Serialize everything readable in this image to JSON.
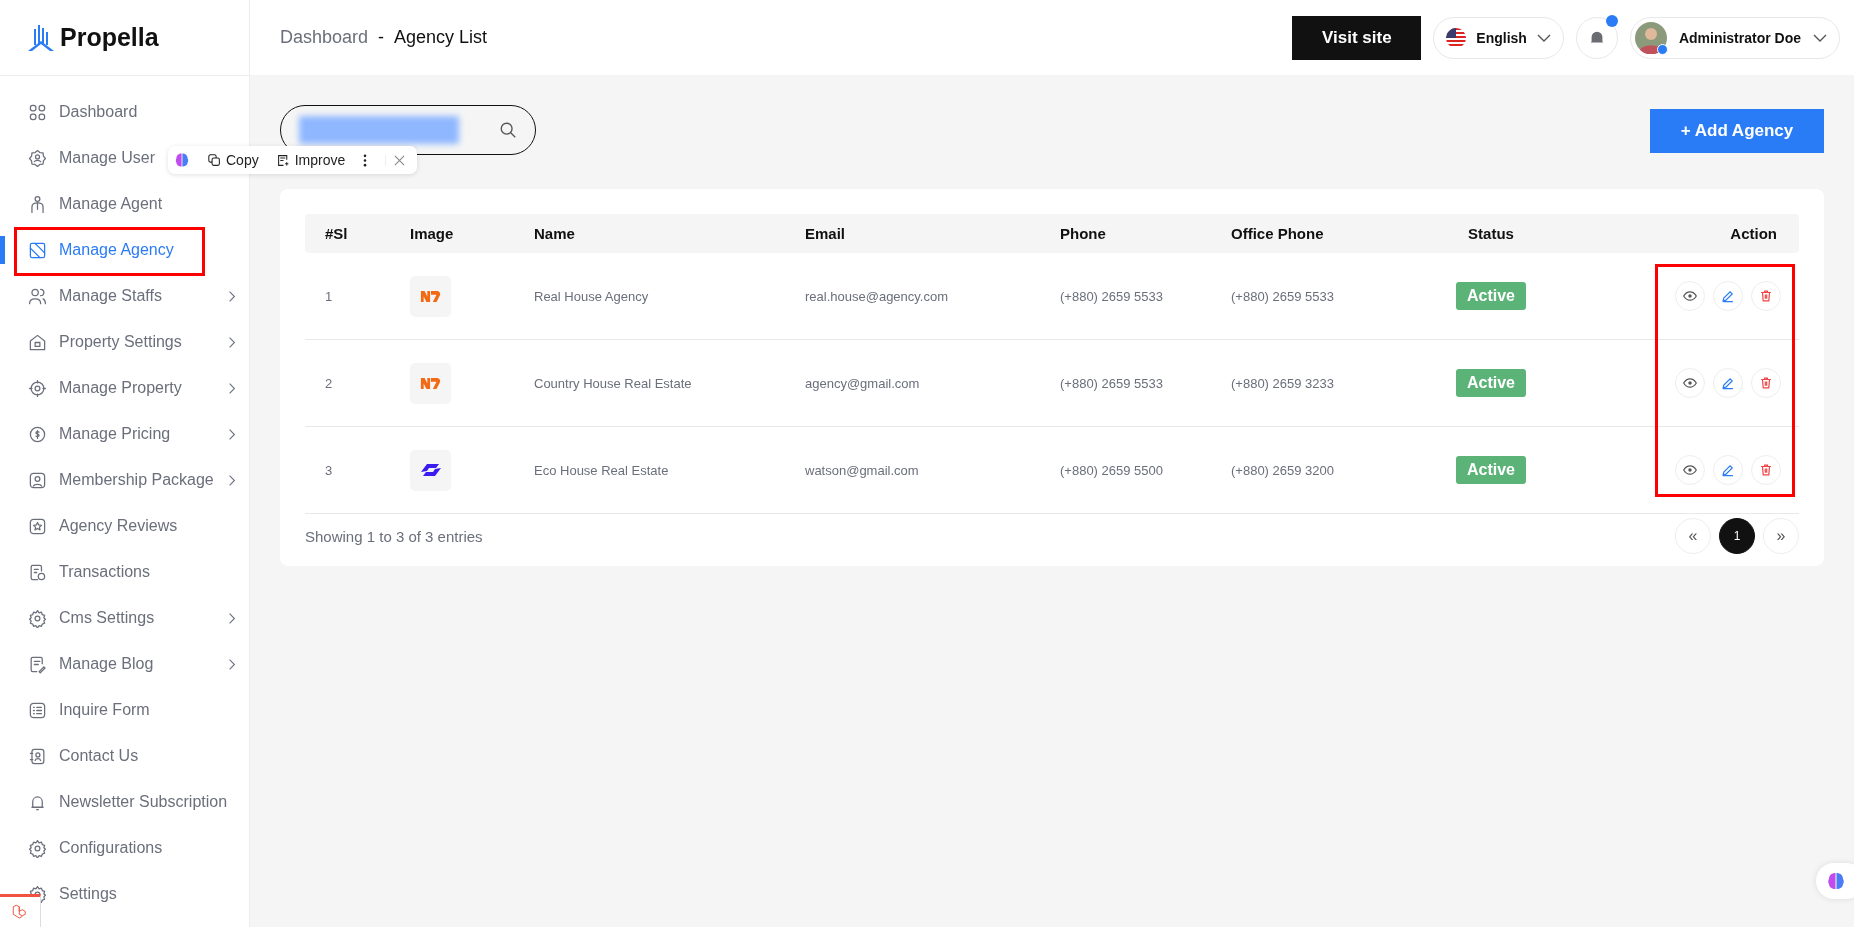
{
  "brand": {
    "name": "Propella"
  },
  "sidebar": {
    "items": [
      {
        "label": "Dashboard",
        "selected": false,
        "has_submenu": false,
        "highlighted": false
      },
      {
        "label": "Manage User",
        "selected": false,
        "has_submenu": false,
        "highlighted": false
      },
      {
        "label": "Manage Agent",
        "selected": false,
        "has_submenu": false,
        "highlighted": false
      },
      {
        "label": "Manage Agency",
        "selected": true,
        "has_submenu": false,
        "highlighted": true
      },
      {
        "label": "Manage Staffs",
        "selected": false,
        "has_submenu": true,
        "highlighted": false
      },
      {
        "label": "Property Settings",
        "selected": false,
        "has_submenu": true,
        "highlighted": false
      },
      {
        "label": "Manage Property",
        "selected": false,
        "has_submenu": true,
        "highlighted": false
      },
      {
        "label": "Manage Pricing",
        "selected": false,
        "has_submenu": true,
        "highlighted": false
      },
      {
        "label": "Membership Package",
        "selected": false,
        "has_submenu": true,
        "highlighted": false
      },
      {
        "label": "Agency Reviews",
        "selected": false,
        "has_submenu": false,
        "highlighted": false
      },
      {
        "label": "Transactions",
        "selected": false,
        "has_submenu": false,
        "highlighted": false
      },
      {
        "label": "Cms Settings",
        "selected": false,
        "has_submenu": true,
        "highlighted": false
      },
      {
        "label": "Manage Blog",
        "selected": false,
        "has_submenu": true,
        "highlighted": false
      },
      {
        "label": "Inquire Form",
        "selected": false,
        "has_submenu": false,
        "highlighted": false
      },
      {
        "label": "Contact Us",
        "selected": false,
        "has_submenu": false,
        "highlighted": false
      },
      {
        "label": "Newsletter Subscription",
        "selected": false,
        "has_submenu": false,
        "highlighted": false
      },
      {
        "label": "Configurations",
        "selected": false,
        "has_submenu": false,
        "highlighted": false
      },
      {
        "label": "Settings",
        "selected": false,
        "has_submenu": false,
        "highlighted": false
      }
    ]
  },
  "selection_popup": {
    "actions": [
      "Copy",
      "Improve"
    ]
  },
  "header": {
    "breadcrumb": [
      "Dashboard",
      "-",
      "Agency List"
    ],
    "visit_button": "Visit site",
    "language": "English",
    "notifications": {
      "unread": true
    },
    "user": {
      "name": "Administrator Doe",
      "online": true
    }
  },
  "toolbar": {
    "add_button": "+ Add Agency"
  },
  "table": {
    "columns": [
      "#Sl",
      "Image",
      "Name",
      "Email",
      "Phone",
      "Office Phone",
      "Status",
      "Action"
    ],
    "actions_highlighted": true,
    "rows": [
      {
        "sl": "1",
        "name": "Real House Agency",
        "email": "real.house@agency.com",
        "phone": "(+880) 2659 5533",
        "office_phone": "(+880) 2659 5533",
        "status": {
          "label": "Active",
          "active": true
        }
      },
      {
        "sl": "2",
        "name": "Country House Real Estate",
        "email": "agency@gmail.com",
        "phone": "(+880) 2659 5533",
        "office_phone": "(+880) 2659 3233",
        "status": {
          "label": "Active",
          "active": true
        }
      },
      {
        "sl": "3",
        "name": "Eco House Real Estate",
        "email": "watson@gmail.com",
        "phone": "(+880) 2659 5500",
        "office_phone": "(+880) 2659 3200",
        "status": {
          "label": "Active",
          "active": true
        }
      }
    ],
    "footer": "Showing 1 to 3 of 3 entries",
    "pagination": [
      {
        "label": "«",
        "selected": false
      },
      {
        "label": "1",
        "selected": true
      },
      {
        "label": "»",
        "selected": false
      }
    ]
  }
}
